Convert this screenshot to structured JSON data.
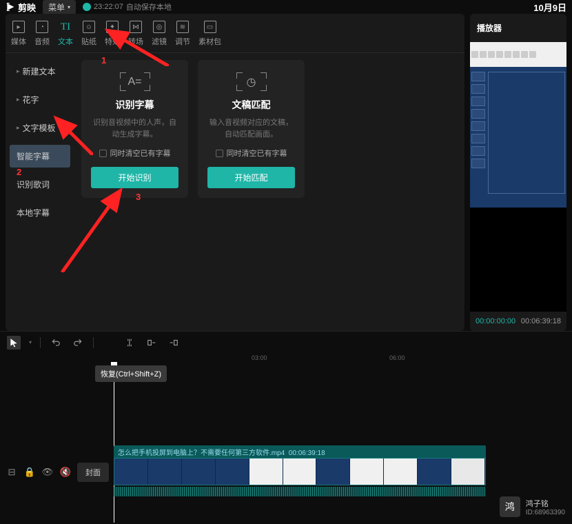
{
  "titlebar": {
    "app": "剪映",
    "menu": "菜单",
    "autosave_time": "23:22:07",
    "autosave_label": "自动保存本地",
    "date": "10月9日"
  },
  "tabs": [
    {
      "label": "媒体",
      "icon": "▸"
    },
    {
      "label": "音频",
      "icon": "◔"
    },
    {
      "label": "文本",
      "icon": "TI"
    },
    {
      "label": "贴纸",
      "icon": "☺"
    },
    {
      "label": "特效",
      "icon": "✦"
    },
    {
      "label": "转场",
      "icon": "⋈"
    },
    {
      "label": "滤镜",
      "icon": "◎"
    },
    {
      "label": "调节",
      "icon": "≈"
    },
    {
      "label": "素材包",
      "icon": "▭"
    }
  ],
  "sidebar": [
    {
      "label": "新建文本",
      "expandable": true
    },
    {
      "label": "花字",
      "expandable": true
    },
    {
      "label": "文字模板",
      "expandable": true
    },
    {
      "label": "智能字幕",
      "expandable": false,
      "active": true
    },
    {
      "label": "识别歌词",
      "expandable": false
    },
    {
      "label": "本地字幕",
      "expandable": false
    }
  ],
  "cards": [
    {
      "title": "识别字幕",
      "desc": "识别音视频中的人声，自动生成字幕。",
      "check_label": "同时清空已有字幕",
      "button": "开始识别"
    },
    {
      "title": "文稿匹配",
      "desc": "输入音视频对应的文稿，自动匹配画面。",
      "check_label": "同时清空已有字幕",
      "button": "开始匹配"
    }
  ],
  "player": {
    "title": "播放器",
    "current": "00:00:00:00",
    "duration": "00:06:39:18"
  },
  "ruler": [
    "03:00",
    "06:00"
  ],
  "tooltip": "恢复(Ctrl+Shift+Z)",
  "cover_btn": "封面",
  "clip": {
    "name": "怎么把手机投屏到电脑上？不需要任何第三方软件.mp4",
    "dur": "00:06:39:18"
  },
  "watermark": {
    "name": "鸿子铭",
    "id": "ID:68963390"
  },
  "annotations": {
    "n1": "1",
    "n2": "2",
    "n3": "3"
  }
}
